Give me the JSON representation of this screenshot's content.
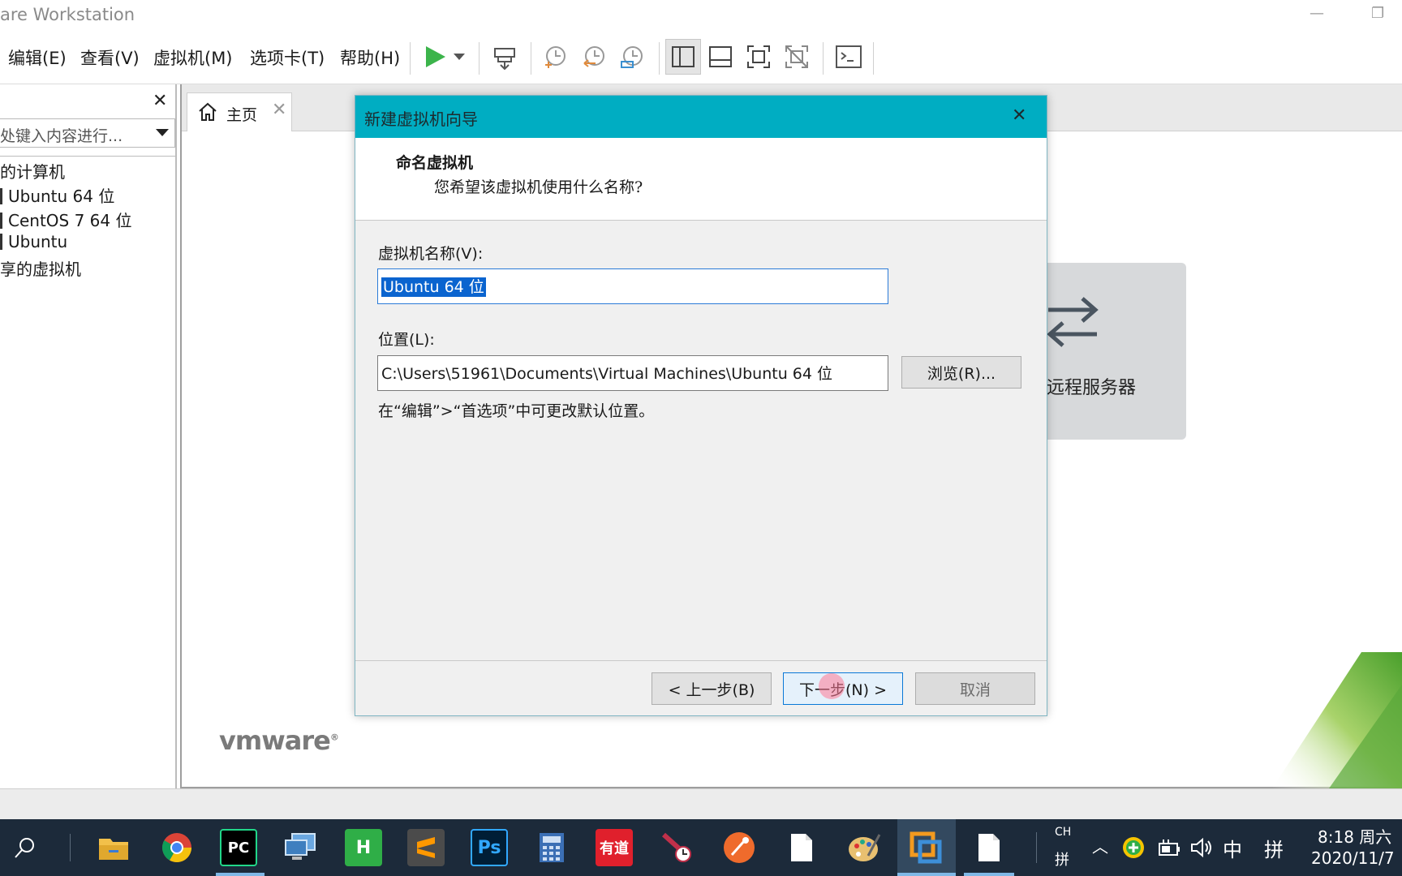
{
  "window": {
    "title": "are Workstation",
    "minimize_glyph": "—",
    "restore_glyph": "❐"
  },
  "menu": {
    "edit": "编辑(E)",
    "view": "查看(V)",
    "vm": "虚拟机(M)",
    "tabs": "选项卡(T)",
    "help": "帮助(H)"
  },
  "toolbar_icons": [
    "play-icon",
    "play-dropdown-icon",
    "suspend-icon",
    "snapshot-icon",
    "revert-snapshot-icon",
    "manage-snapshots-icon",
    "sidebar-view-icon",
    "thumbnail-view-icon",
    "fullscreen-icon",
    "unity-icon",
    "console-icon"
  ],
  "sidebar": {
    "close_glyph": "✕",
    "search_placeholder": "正处键入内容进行...",
    "search_visible": "处键入内容进行...",
    "items": [
      {
        "label": "的计算机"
      },
      {
        "label": "Ubuntu 64 位"
      },
      {
        "label": "CentOS 7 64 位"
      },
      {
        "label": "Ubuntu"
      },
      {
        "label": "享的虚拟机"
      }
    ]
  },
  "tabs": {
    "home_label": "主页",
    "close_glyph": "✕"
  },
  "home": {
    "remote_server_label": "远程服务器",
    "logo_text": "vmware"
  },
  "dialog": {
    "title": "新建虚拟机向导",
    "close_glyph": "✕",
    "heading": "命名虚拟机",
    "subheading": "您希望该虚拟机使用什么名称?",
    "name_label": "虚拟机名称(V):",
    "name_value": "Ubuntu 64 位",
    "location_label": "位置(L):",
    "location_value": "C:\\Users\\51961\\Documents\\Virtual Machines\\Ubuntu 64 位",
    "browse_button": "浏览(R)...",
    "hint": "在“编辑”>“首选项”中可更改默认位置。",
    "back_button": "< 上一步(B)",
    "next_button": "下一步(N) >",
    "cancel_button": "取消"
  },
  "taskbar": {
    "apps": [
      {
        "name": "file-explorer-icon",
        "color": "#f2c04a"
      },
      {
        "name": "chrome-icon",
        "color": "#ffffff"
      },
      {
        "name": "pycharm-icon",
        "color": "#21d789"
      },
      {
        "name": "remote-desktop-icon",
        "color": "#6aa7e0"
      },
      {
        "name": "hbuilder-icon",
        "color": "#2fae47"
      },
      {
        "name": "sublime-icon",
        "color": "#4b4b4b"
      },
      {
        "name": "photoshop-icon",
        "color": "#2a3e8c"
      },
      {
        "name": "calculator-icon",
        "color": "#3b6fb5"
      },
      {
        "name": "youdao-icon",
        "color": "#e0202c"
      },
      {
        "name": "screen-pen-icon",
        "color": "#c0304a"
      },
      {
        "name": "postman-icon",
        "color": "#ef6b2c"
      },
      {
        "name": "file-icon",
        "color": "#ffffff"
      },
      {
        "name": "paint-icon",
        "color": "#e8c070"
      },
      {
        "name": "vmware-icon",
        "color": "#f39a1f"
      },
      {
        "name": "document-icon",
        "color": "#ffffff"
      }
    ],
    "pycharm_label": "PC",
    "hbuilder_label": "H",
    "photoshop_label": "Ps",
    "youdao_label": "有道",
    "lang_ch": "CH",
    "ime_small": "拼",
    "ime_mode": "中",
    "ime_pinyin": "拼",
    "time": "8:18 周六",
    "date": "2020/11/7"
  },
  "colors": {
    "dialog_title_bg": "#00adc2",
    "selection": "#0a64cf",
    "taskbar_bg": "#1c2a3a",
    "play_green": "#3cb44b",
    "vmware_green": "#6db33f"
  }
}
